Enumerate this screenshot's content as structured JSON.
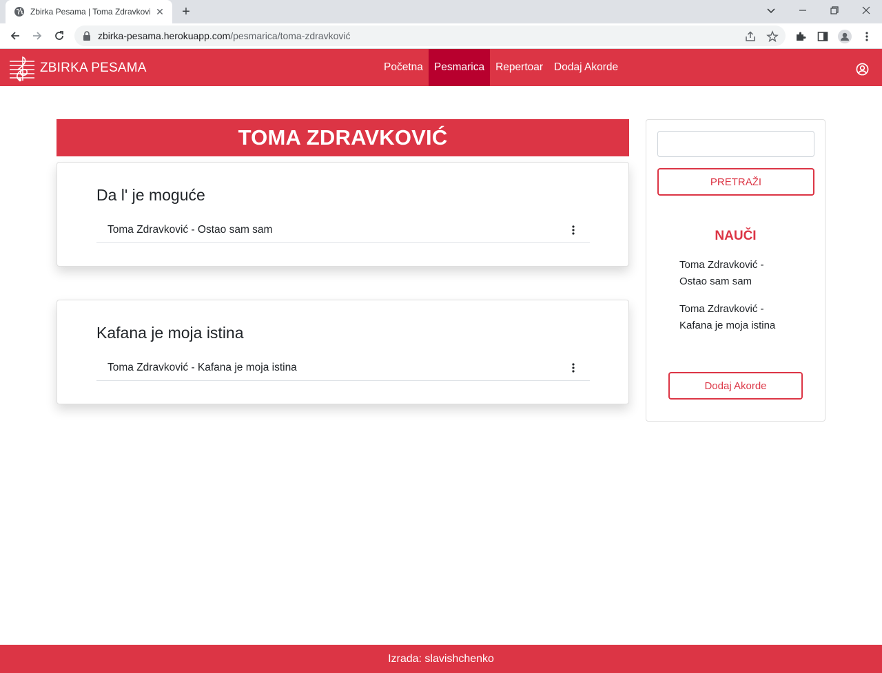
{
  "browser": {
    "tab_title": "Zbirka Pesama | Toma Zdravković",
    "url_host": "zbirka-pesama.herokuapp.com",
    "url_path": "/pesmarica/toma-zdravković",
    "new_tab_label": "+",
    "close_tab_label": "✕"
  },
  "site": {
    "brand": "ZBIRKA PESAMA",
    "accent_color": "#dc3545",
    "active_nav_color": "#b8002e",
    "nav": [
      {
        "label": "Početna",
        "active": false
      },
      {
        "label": "Pesmarica",
        "active": true
      },
      {
        "label": "Repertoar",
        "active": false
      },
      {
        "label": "Dodaj Akorde",
        "active": false
      }
    ]
  },
  "main": {
    "artist": "TOMA ZDRAVKOVIĆ",
    "albums": [
      {
        "title": "Da l' je moguće",
        "songs": [
          "Toma Zdravković - Ostao sam sam"
        ]
      },
      {
        "title": "Kafana je moja istina",
        "songs": [
          "Toma Zdravković - Kafana je moja istina"
        ]
      }
    ]
  },
  "sidebar": {
    "search_value": "",
    "search_button": "PRETRAŽI",
    "learn_title": "NAUČI",
    "learn_items": [
      {
        "line1": "Toma Zdravković -",
        "line2": "Ostao sam sam"
      },
      {
        "line1": "Toma Zdravković -",
        "line2": "Kafana je moja istina"
      }
    ],
    "add_button": "Dodaj Akorde"
  },
  "footer": {
    "text": "Izrada: slavishchenko"
  }
}
